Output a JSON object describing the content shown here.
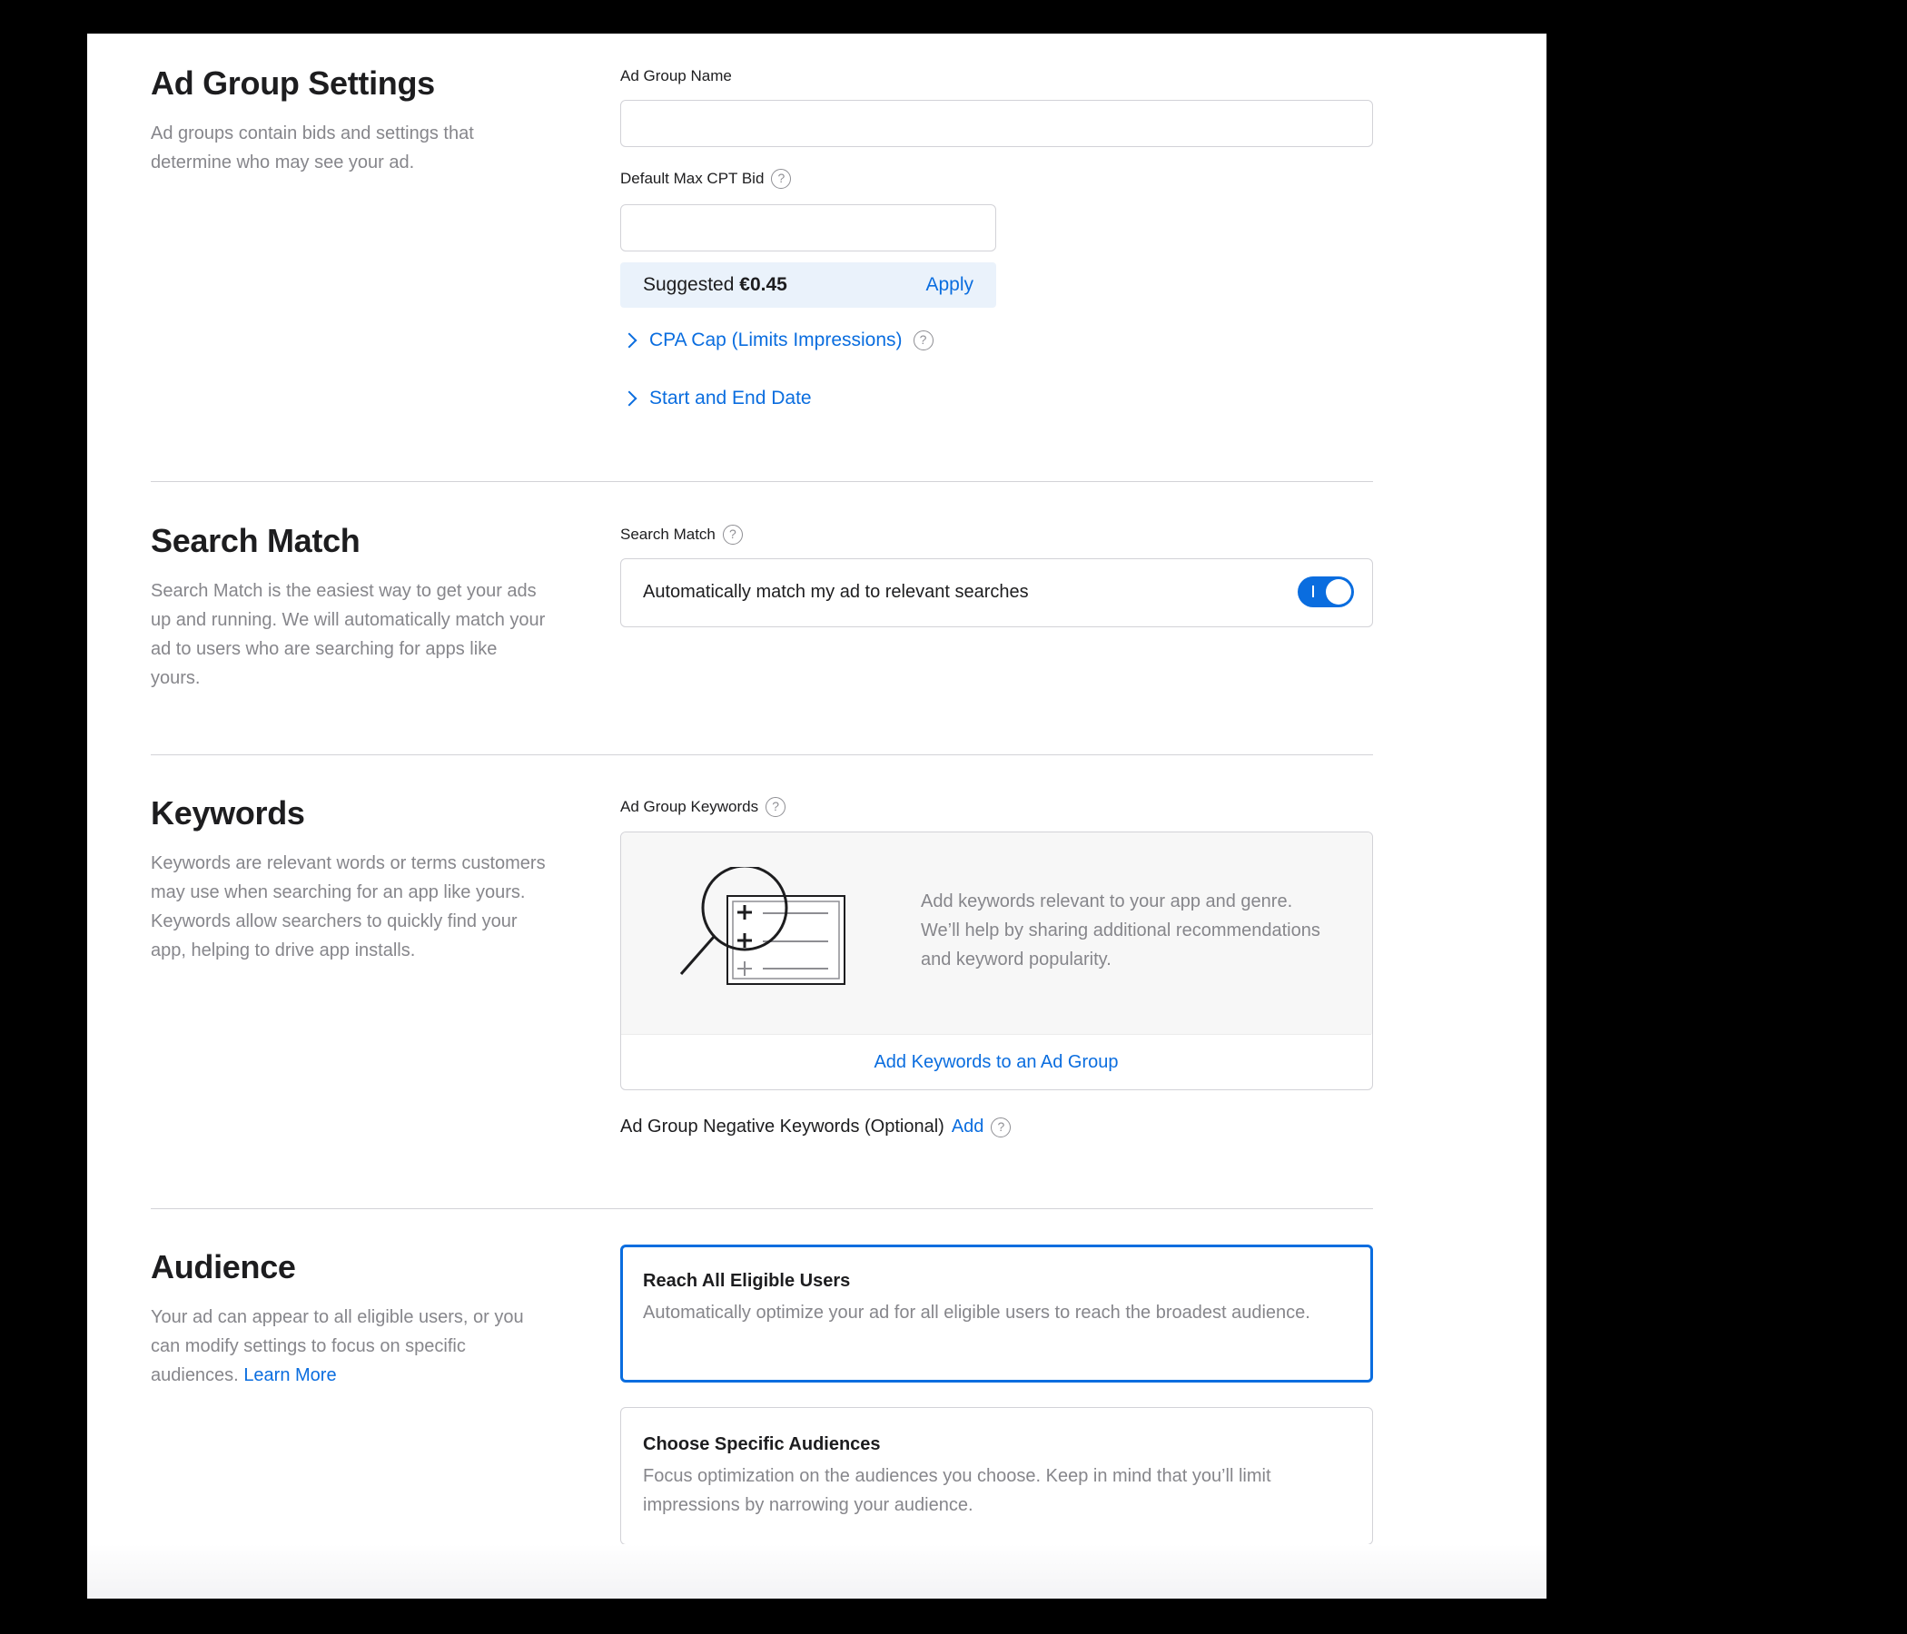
{
  "ad_group_settings": {
    "title": "Ad Group Settings",
    "description": "Ad groups contain bids and settings that determine who may see your ad.",
    "name_label": "Ad Group Name",
    "name_value": "",
    "bid_label": "Default Max CPT Bid",
    "bid_value": "",
    "suggested_prefix": "Suggested",
    "suggested_amount": "€0.45",
    "apply_label": "Apply",
    "cpa_cap_label": "CPA Cap (Limits Impressions)",
    "dates_label": "Start and End Date"
  },
  "search_match": {
    "title": "Search Match",
    "description": "Search Match is the easiest way to get your ads up and running. We will automatically match your ad to users who are searching for apps like yours.",
    "field_label": "Search Match",
    "toggle_text": "Automatically match my ad to relevant searches",
    "toggle_on": true
  },
  "keywords": {
    "title": "Keywords",
    "description": "Keywords are relevant words or terms customers may use when searching for an app like yours. Keywords allow searchers to quickly find your app, helping to drive app installs.",
    "field_label": "Ad Group Keywords",
    "empty_text": "Add keywords relevant to your app and genre. We’ll help by sharing additional recommendations and keyword popularity.",
    "add_link": "Add Keywords to an Ad Group",
    "negative_label": "Ad Group Negative Keywords (Optional)",
    "negative_add": "Add"
  },
  "audience": {
    "title": "Audience",
    "description": "Your ad can appear to all eligible users, or you can modify settings to focus on specific audiences.",
    "learn_more": "Learn More",
    "options": [
      {
        "title": "Reach All Eligible Users",
        "description": "Automatically optimize your ad for all eligible users to reach the broadest audience.",
        "selected": true
      },
      {
        "title": "Choose Specific Audiences",
        "description": "Focus optimization on the audiences you choose. Keep in mind that you’ll limit impressions by narrowing your audience.",
        "selected": false
      }
    ]
  },
  "icons": {
    "help": "question-circle-icon",
    "chevron": "chevron-right-icon",
    "keywords_illustration": "magnifier-list-icon"
  },
  "colors": {
    "accent": "#0a6ddf",
    "suggest_bg": "#eaf2fb",
    "muted_text": "#86868b"
  }
}
